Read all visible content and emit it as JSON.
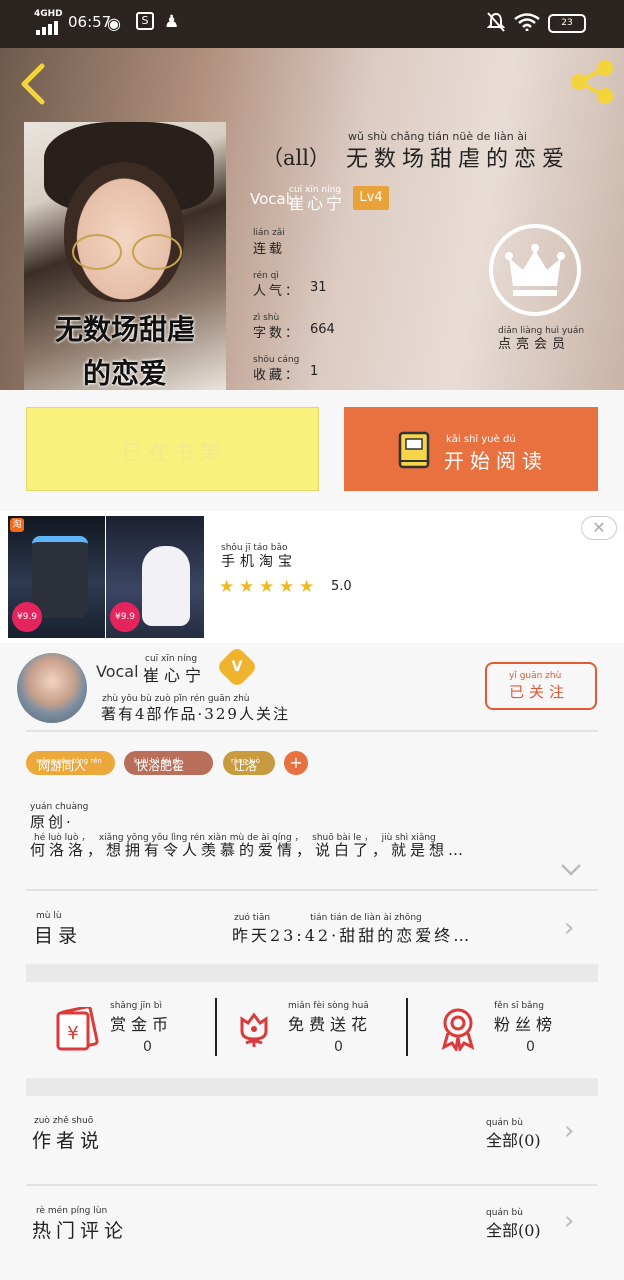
{
  "status_bar": {
    "network": "4GHD",
    "time": "06:57",
    "battery": "23"
  },
  "book": {
    "title_pinyin": "wǔ shù chǎng tián nüè de liàn ài",
    "title_prefix": "（all）",
    "title": "无数场甜虐的恋爱",
    "cover_title_line1": "无数场甜虐",
    "cover_title_line2": "的恋爱",
    "author_prefix": "Vocal",
    "author_pinyin": "cuī xīn níng",
    "author_name": "崔心宁",
    "level": "Lv4",
    "status_pinyin": "lián zǎi",
    "status": "连载",
    "popularity_pinyin": "rén qì",
    "popularity_label": "人气：",
    "popularity": "31",
    "words_pinyin": "zì shù",
    "words_label": "字数：",
    "words": "664",
    "favorites_pinyin": "shōu cáng",
    "favorites_label": "收藏：",
    "favorites": "1",
    "vip_pinyin": "diǎn liàng huì yuán",
    "vip_label": "点亮会员"
  },
  "actions": {
    "add_shelf": "已在书架",
    "read_pinyin": "kāi shǐ yuè dú",
    "read": "开始阅读"
  },
  "ad": {
    "app_pinyin": "shǒu jī táo bǎo",
    "app_name": "手机淘宝",
    "rating": "5.0",
    "price1": "¥9.9",
    "price2": "¥9.9"
  },
  "author_card": {
    "name_prefix": "Vocal",
    "name_pinyin": "cuī xīn níng",
    "name": "崔心宁",
    "badge": "V",
    "stats_pinyin": "zhù yǒu  bù zuò pǐn        rén guān zhù",
    "stats": "著有4部作品·329人关注",
    "follow_pinyin": "yǐ guān zhù",
    "follow": "已关注"
  },
  "tags": [
    {
      "pinyin": "wǎng yóu tóng rén",
      "label": "网游同人",
      "color": "#eda83b"
    },
    {
      "pinyin": "kuài hǔ féi dí",
      "label": "快浴肥霍",
      "color": "#b86e58"
    },
    {
      "pinyin": "ràng luò",
      "label": "让洛",
      "color": "#c89b3e"
    }
  ],
  "intro": {
    "line1_pinyin": "yuán chuàng",
    "line1": "原创·",
    "line2_pinyin": "hé luò luò ，   xiǎng yōng yǒu lìng rén xiàn mù de ài qíng ，   shuō bài le ，   jiù shì xiǎng",
    "line2": "何洛洛，想拥有令人羡慕的爱情，说白了，就是想…"
  },
  "catalog": {
    "label_pinyin": "mù lù",
    "label": "目录",
    "latest_pinyin": "zuó tiān              tián tián de liàn ài zhōng",
    "latest": "昨天23:42·甜甜的恋爱终…"
  },
  "rewards": [
    {
      "pinyin": "shǎng jīn bì",
      "label": "赏金币",
      "count": "0"
    },
    {
      "pinyin": "miǎn fèi sòng huā",
      "label": "免费送花",
      "count": "0"
    },
    {
      "pinyin": "fěn sī bǎng",
      "label": "粉丝榜",
      "count": "0"
    }
  ],
  "author_says": {
    "label_pinyin": "zuò zhě shuō",
    "label": "作者说",
    "all_pinyin": "quán bù",
    "all": "全部(0)"
  },
  "hot_comments": {
    "label_pinyin": "rè mén píng lùn",
    "label": "热门评论",
    "all_pinyin": "quán bù",
    "all": "全部(0)"
  }
}
